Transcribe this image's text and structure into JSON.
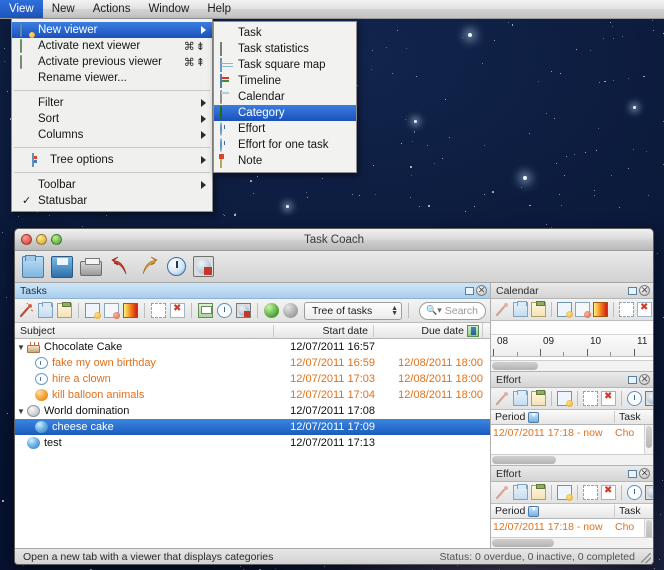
{
  "menubar": {
    "items": [
      {
        "label": "View",
        "active": true
      },
      {
        "label": "New",
        "active": false
      },
      {
        "label": "Actions",
        "active": false
      },
      {
        "label": "Window",
        "active": false
      },
      {
        "label": "Help",
        "active": false
      }
    ]
  },
  "view_menu": {
    "items": [
      {
        "label": "New viewer",
        "icon": "new-viewer-icon",
        "shortcut": "",
        "submenu": true,
        "selected": true,
        "checked": false
      },
      {
        "label": "Activate next viewer",
        "icon": "next-viewer-icon",
        "shortcut": "⌘⇟",
        "submenu": false,
        "selected": false,
        "checked": false
      },
      {
        "label": "Activate previous viewer",
        "icon": "previous-viewer-icon",
        "shortcut": "⌘⇞",
        "submenu": false,
        "selected": false,
        "checked": false
      },
      {
        "label": "Rename viewer...",
        "icon": "",
        "shortcut": "",
        "submenu": false,
        "selected": false,
        "checked": false
      },
      {
        "separator": true
      },
      {
        "label": "Filter",
        "icon": "",
        "shortcut": "",
        "submenu": true,
        "selected": false,
        "checked": false
      },
      {
        "label": "Sort",
        "icon": "",
        "shortcut": "",
        "submenu": true,
        "selected": false,
        "checked": false
      },
      {
        "label": "Columns",
        "icon": "",
        "shortcut": "",
        "submenu": true,
        "selected": false,
        "checked": false
      },
      {
        "separator": true
      },
      {
        "label": "Tree options",
        "icon": "tree-options-icon",
        "shortcut": "",
        "submenu": true,
        "selected": false,
        "checked": false
      },
      {
        "separator": true
      },
      {
        "label": "Toolbar",
        "icon": "",
        "shortcut": "",
        "submenu": true,
        "selected": false,
        "checked": false
      },
      {
        "label": "Statusbar",
        "icon": "",
        "shortcut": "",
        "submenu": false,
        "selected": false,
        "checked": true
      }
    ]
  },
  "new_viewer_submenu": {
    "items": [
      {
        "label": "Task",
        "icon": "task-globe-icon",
        "selected": false
      },
      {
        "label": "Task statistics",
        "icon": "task-statistics-icon",
        "selected": false
      },
      {
        "label": "Task square map",
        "icon": "task-square-map-icon",
        "selected": false
      },
      {
        "label": "Timeline",
        "icon": "timeline-icon",
        "selected": false
      },
      {
        "label": "Calendar",
        "icon": "calendar-icon",
        "selected": false
      },
      {
        "label": "Category",
        "icon": "category-icon",
        "selected": true
      },
      {
        "label": "Effort",
        "icon": "effort-icon",
        "selected": false
      },
      {
        "label": "Effort for one task",
        "icon": "effort-one-task-icon",
        "selected": false
      },
      {
        "label": "Note",
        "icon": "note-icon",
        "selected": false
      }
    ]
  },
  "window": {
    "title": "Task Coach",
    "toolbar": [
      {
        "name": "open-file-button",
        "icon": "folder-open-icon"
      },
      {
        "name": "save-file-button",
        "icon": "floppy-save-icon"
      },
      {
        "name": "print-button",
        "icon": "printer-icon"
      },
      {
        "name": "undo-button",
        "icon": "undo-arrow-icon"
      },
      {
        "name": "redo-button",
        "icon": "redo-arrow-icon"
      },
      {
        "name": "start-tracking-button",
        "icon": "clock-icon"
      },
      {
        "name": "stop-tracking-button",
        "icon": "stop-clock-icon"
      }
    ]
  },
  "tasks_panel": {
    "title": "Tasks",
    "view_selector": {
      "value": "Tree of tasks"
    },
    "search": {
      "placeholder": "Search",
      "value": ""
    },
    "columns": [
      {
        "label": "Subject"
      },
      {
        "label": "Start date"
      },
      {
        "label": "Due date",
        "sort_icon": "sort-indicator-icon"
      }
    ],
    "rows": [
      {
        "subject": "Chocolate Cake",
        "start": "12/07/2011 16:57",
        "due": "",
        "level": 0,
        "expanded": true,
        "icon": "cake-icon",
        "overdue": false,
        "selected": false
      },
      {
        "subject": "fake my own birthday",
        "start": "12/07/2011 16:59",
        "due": "12/08/2011 18:00",
        "level": 1,
        "expanded": null,
        "icon": "clock-icon",
        "overdue": true,
        "selected": false
      },
      {
        "subject": "hire a clown",
        "start": "12/07/2011 17:03",
        "due": "12/08/2011 18:00",
        "level": 1,
        "expanded": null,
        "icon": "clock-icon",
        "overdue": true,
        "selected": false
      },
      {
        "subject": "kill balloon animals",
        "start": "12/07/2011 17:04",
        "due": "12/08/2011 18:00",
        "level": 1,
        "expanded": null,
        "icon": "orange-ball-icon",
        "overdue": true,
        "selected": false
      },
      {
        "subject": "World domination",
        "start": "12/07/2011 17:08",
        "due": "",
        "level": 0,
        "expanded": true,
        "icon": "world-icon",
        "overdue": false,
        "selected": false
      },
      {
        "subject": "cheese cake",
        "start": "12/07/2011 17:09",
        "due": "",
        "level": 1,
        "expanded": null,
        "icon": "blue-ball-icon",
        "overdue": false,
        "selected": true
      },
      {
        "subject": "test",
        "start": "12/07/2011 17:13",
        "due": "",
        "level": 0,
        "expanded": null,
        "icon": "blue-ball-icon",
        "overdue": false,
        "selected": false
      }
    ]
  },
  "calendar_panel": {
    "title": "Calendar",
    "ruler_labels": [
      "08",
      "09",
      "10",
      "11"
    ]
  },
  "effort_panel_1": {
    "title": "Effort",
    "columns": [
      {
        "label": "Period",
        "sort_icon": "sort-down-icon"
      },
      {
        "label": "Task"
      }
    ],
    "rows": [
      {
        "period": "12/07/2011 17:18 - now",
        "task": "Cho"
      }
    ]
  },
  "effort_panel_2": {
    "title": "Effort",
    "columns": [
      {
        "label": "Period",
        "sort_icon": "sort-down-icon"
      },
      {
        "label": "Task"
      }
    ],
    "rows": [
      {
        "period": "12/07/2011 17:18 - now",
        "task": "Cho"
      }
    ]
  },
  "statusbar": {
    "left": "Open a new tab with a viewer that displays categories",
    "right": "Status: 0 overdue, 0 inactive, 0 completed"
  },
  "colors": {
    "menu_highlight": "#1d55bd",
    "row_selected": "#1a5bbd",
    "overdue_text": "#e0711c",
    "panel_title_active": "#a8cdec",
    "desktop": "#0b1a3a"
  }
}
